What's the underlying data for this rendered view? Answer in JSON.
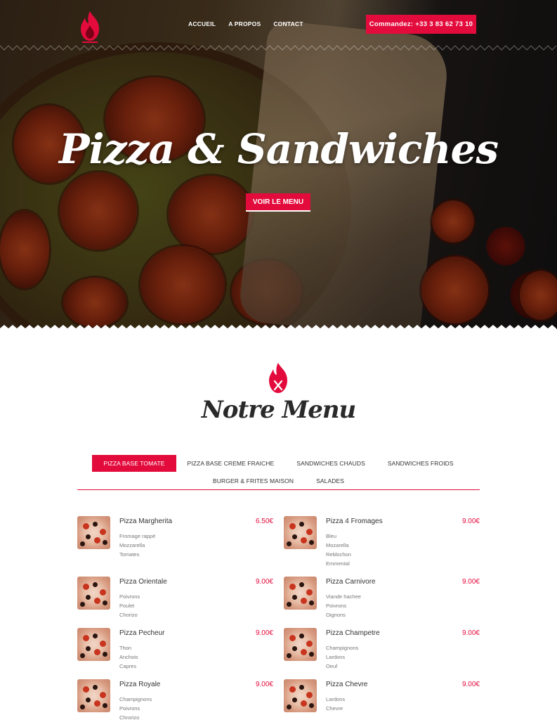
{
  "nav": {
    "items": [
      {
        "label": "ACCUEIL"
      },
      {
        "label": "A PROPOS"
      },
      {
        "label": "CONTACT"
      }
    ],
    "order_label": "Commandez: +33 3 83 62 73 10"
  },
  "hero": {
    "title": "Pizza & Sandwiches",
    "cta_label": "VOIR LE MENU"
  },
  "menu": {
    "title": "Notre Menu",
    "tabs_row1": [
      {
        "label": "PIZZA BASE TOMATE",
        "active": true
      },
      {
        "label": "PIZZA BASE CREME FRAICHE"
      },
      {
        "label": "SANDWICHES CHAUDS"
      },
      {
        "label": "SANDWICHES FROIDS"
      }
    ],
    "tabs_row2": [
      {
        "label": "BURGER & FRITES MAISON"
      },
      {
        "label": "SALADES"
      }
    ],
    "items": [
      {
        "name": "Pizza Margherita",
        "price": "6.50€",
        "ingredients": [
          "Fromage rappé",
          "Mozzarella",
          "Tomates"
        ]
      },
      {
        "name": "Pizza 4 Fromages",
        "price": "9.00€",
        "ingredients": [
          "Bleu",
          "Mozarella",
          "Reblochon",
          "Emmental"
        ]
      },
      {
        "name": "Pizza Orientale",
        "price": "9.00€",
        "ingredients": [
          "Poivrons",
          "Poulet",
          "Chorizo"
        ]
      },
      {
        "name": "Pizza Carnivore",
        "price": "9.00€",
        "ingredients": [
          "Viande hachee",
          "Poivrons",
          "Oignons"
        ]
      },
      {
        "name": "Pizza Pecheur",
        "price": "9.00€",
        "ingredients": [
          "Thon",
          "Anchois",
          "Capres"
        ]
      },
      {
        "name": "Pizza Champetre",
        "price": "9.00€",
        "ingredients": [
          "Champignons",
          "Lardons",
          "Oeuf"
        ]
      },
      {
        "name": "Pizza Royale",
        "price": "9.00€",
        "ingredients": [
          "Champignons",
          "Poivrons",
          "Chrorizo"
        ]
      },
      {
        "name": "Pizza Chevre",
        "price": "9.00€",
        "ingredients": [
          "Lardons",
          "Chevre"
        ]
      }
    ]
  },
  "colors": {
    "accent": "#e30b3c"
  },
  "icons": {
    "logo": "flame-icon",
    "menu_emblem": "flame-fork-knife-icon"
  }
}
